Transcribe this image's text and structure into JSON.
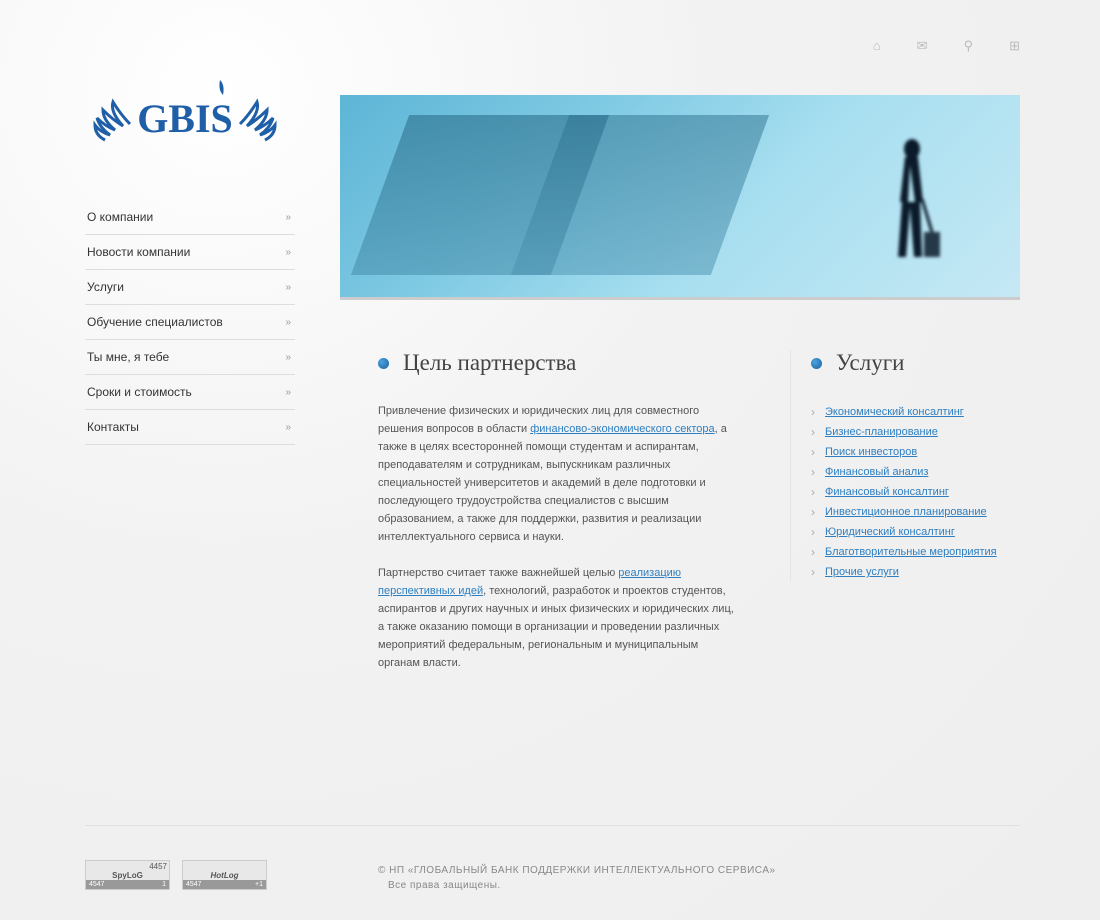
{
  "logo": {
    "text": "GBIS"
  },
  "topIcons": {
    "home": "⌂",
    "mail": "✉",
    "search": "⚲",
    "sitemap": "⊞"
  },
  "nav": {
    "items": [
      {
        "label": "О компании"
      },
      {
        "label": "Новости компании"
      },
      {
        "label": "Услуги"
      },
      {
        "label": "Обучение специалистов"
      },
      {
        "label": "Ты мне, я тебе"
      },
      {
        "label": "Сроки и стоимость"
      },
      {
        "label": "Контакты"
      }
    ]
  },
  "main": {
    "heading": "Цель партнерства",
    "p1_a": "Привлечение физических и юридических лиц для совместного решения вопросов в области ",
    "p1_link": "финансово-экономического сектора",
    "p1_b": ", а также в целях всесторонней помощи студентам и аспирантам, преподавателям и сотрудникам, выпускникам различных специальностей университетов и академий в деле подготовки и последующего трудоустройства специалистов с высшим образованием, а также для поддержки, развития и реализации интеллектуального сервиса и науки.",
    "p2_a": "Партнерство считает также важнейшей целью ",
    "p2_link": "реализацию перспективных идей",
    "p2_b": ", технологий, разработок и проектов студентов, аспирантов и других научных и иных физических и юридических лиц, а также оказанию помощи в организации и проведении различных мероприятий федеральным, региональным и муниципальным органам власти."
  },
  "services": {
    "heading": "Услуги",
    "items": [
      {
        "label": "Экономический консалтинг"
      },
      {
        "label": "Бизнес-планирование"
      },
      {
        "label": "Поиск инвесторов"
      },
      {
        "label": "Финансовый анализ"
      },
      {
        "label": "Финансовый консалтинг"
      },
      {
        "label": "Инвестиционное планирование"
      },
      {
        "label": "Юридический консалтинг"
      },
      {
        "label": "Благотворительные мероприятия"
      },
      {
        "label": "Прочие услуги"
      }
    ]
  },
  "counters": {
    "c1": {
      "name": "SpyLoG",
      "top": "4457",
      "topRight": "1",
      "bottom": "4547",
      "bottomRight": "1"
    },
    "c2": {
      "name": "HotLog",
      "bottom": "4547",
      "bottomRight": "+1"
    }
  },
  "footer": {
    "line1": "© НП «ГЛОБАЛЬНЫЙ БАНК ПОДДЕРЖКИ ИНТЕЛЛЕКТУАЛЬНОГО СЕРВИСА»",
    "line2": "Все права защищены."
  }
}
